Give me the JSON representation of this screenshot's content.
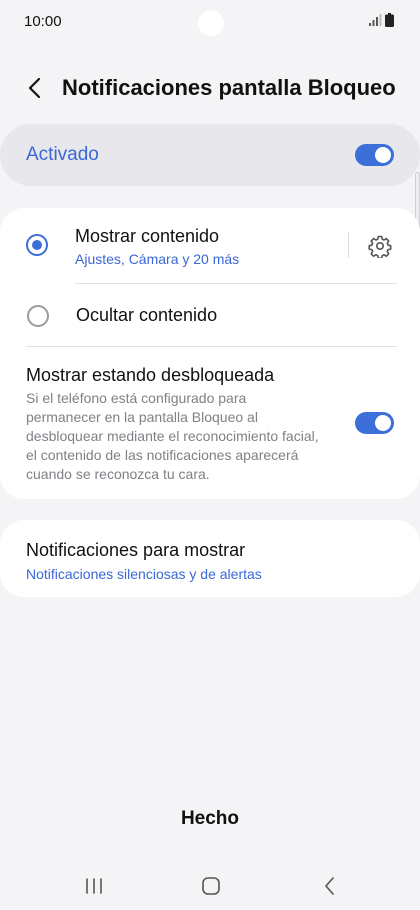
{
  "status": {
    "time": "10:00"
  },
  "header": {
    "title": "Notificaciones pantalla Bloqueo"
  },
  "master": {
    "label": "Activado",
    "enabled": true
  },
  "options": [
    {
      "title": "Mostrar contenido",
      "subtitle": "Ajustes, Cámara y 20 más",
      "selected": true
    },
    {
      "title": "Ocultar contenido",
      "selected": false
    }
  ],
  "unlocked": {
    "title": "Mostrar estando desbloqueada",
    "description_lines": [
      "Si el teléfono está configurado para",
      "permanecer en la pantalla Bloqueo al",
      "desbloquear mediante el reconocimiento facial,",
      "el contenido de las notificaciones aparecerá",
      "cuando se reconozca tu cara."
    ],
    "enabled": true
  },
  "notifications_to_show": {
    "title": "Notificaciones para mostrar",
    "subtitle": "Notificaciones silenciosas y de alertas"
  },
  "footer": {
    "done_label": "Hecho"
  },
  "icons": {
    "back": "back-arrow-icon",
    "settings": "gear-icon",
    "nav": [
      "recent-apps-icon",
      "home-icon",
      "back-icon"
    ]
  },
  "colors": {
    "accent": "#3c6fd8",
    "accent_text": "#3a68d6",
    "background": "#f4f4f6",
    "card": "#ffffff",
    "master_card": "#e7e7ec"
  }
}
